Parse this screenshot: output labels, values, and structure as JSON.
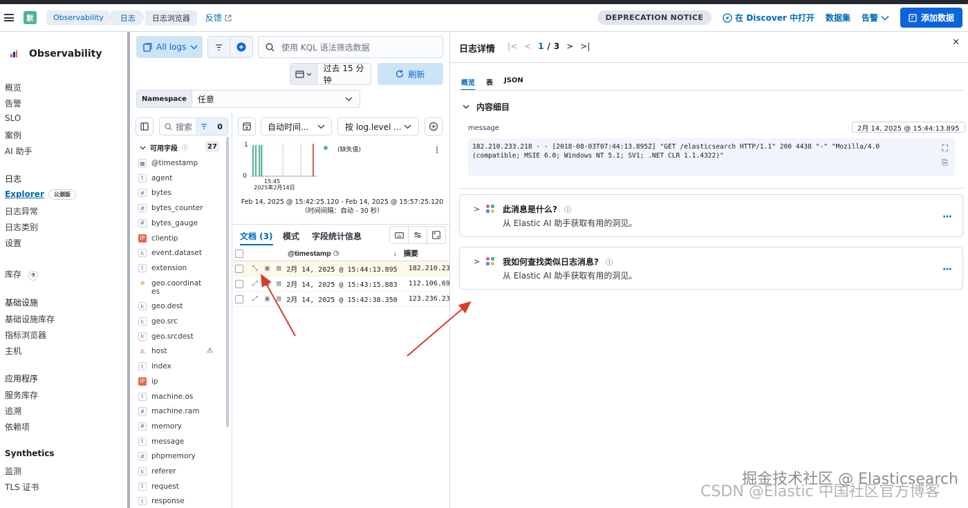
{
  "header": {
    "space_initial": "默",
    "breadcrumbs": [
      "Observability",
      "日志",
      "日志浏览器"
    ],
    "feedback": "反馈",
    "deprecation": "DEPRECATION NOTICE",
    "open_in_discover": "在 Discover 中打开",
    "datasets": "数据集",
    "alerts": "告警",
    "add_data": "添加数据"
  },
  "sidebar": {
    "brand": "Observability",
    "items": [
      {
        "label": "概览",
        "type": "item"
      },
      {
        "label": "告警",
        "type": "item"
      },
      {
        "label": "SLO",
        "type": "item"
      },
      {
        "label": "案例",
        "type": "item"
      },
      {
        "label": "AI 助手",
        "type": "item"
      },
      {
        "label": "日志",
        "type": "group"
      },
      {
        "label": "Explorer",
        "type": "active",
        "badge": "公测版"
      },
      {
        "label": "日志异常",
        "type": "item"
      },
      {
        "label": "日志类别",
        "type": "item"
      },
      {
        "label": "设置",
        "type": "item"
      },
      {
        "label": "库存",
        "type": "group-plain"
      },
      {
        "label": "基础设施",
        "type": "group"
      },
      {
        "label": "基础设施库存",
        "type": "item"
      },
      {
        "label": "指标浏览器",
        "type": "item"
      },
      {
        "label": "主机",
        "type": "item"
      },
      {
        "label": "应用程序",
        "type": "group"
      },
      {
        "label": "服务库存",
        "type": "item"
      },
      {
        "label": "追溯",
        "type": "item"
      },
      {
        "label": "依赖项",
        "type": "item"
      },
      {
        "label": "Synthetics",
        "type": "group"
      },
      {
        "label": "监测",
        "type": "item"
      },
      {
        "label": "TLS 证书",
        "type": "item"
      }
    ]
  },
  "filters": {
    "dataview": "All logs",
    "kql_placeholder": "使用 KQL 语法筛选数据",
    "time_range": "过去 15 分钟",
    "refresh": "刷新",
    "namespace_label": "Namespace",
    "namespace_value": "任意"
  },
  "fields": {
    "search": "搜索",
    "filter_count": "0",
    "available_label": "可用字段",
    "available_count": "27",
    "list": [
      {
        "name": "@timestamp",
        "type": "calendar"
      },
      {
        "name": "agent",
        "type": "t"
      },
      {
        "name": "bytes",
        "type": "#"
      },
      {
        "name": "bytes_counter",
        "type": "#"
      },
      {
        "name": "bytes_gauge",
        "type": "#"
      },
      {
        "name": "clientip",
        "type": "ip"
      },
      {
        "name": "event.dataset",
        "type": "k"
      },
      {
        "name": "extension",
        "type": "t"
      },
      {
        "name": "geo.coordinat es",
        "type": "geo"
      },
      {
        "name": "geo.dest",
        "type": "k"
      },
      {
        "name": "geo.src",
        "type": "k"
      },
      {
        "name": "geo.srcdest",
        "type": "k"
      },
      {
        "name": "host",
        "type": "warn"
      },
      {
        "name": "index",
        "type": "t"
      },
      {
        "name": "ip",
        "type": "ip"
      },
      {
        "name": "machine.os",
        "type": "t"
      },
      {
        "name": "machine.ram",
        "type": "#"
      },
      {
        "name": "memory",
        "type": "#"
      },
      {
        "name": "message",
        "type": "t"
      },
      {
        "name": "phpmemory",
        "type": "#"
      },
      {
        "name": "referer",
        "type": "k"
      },
      {
        "name": "request",
        "type": "t"
      },
      {
        "name": "response",
        "type": "t"
      }
    ]
  },
  "histogram": {
    "interval_select": "自动时间...",
    "breakdown_select": "按 log.level ...",
    "y_top": "1",
    "y_bottom": "0",
    "x_tick_time": "15:45",
    "x_tick_date": "2025年2月14日",
    "legend": "(缺失值)",
    "range_text": "Feb 14, 2025 @ 15:42:25.120 - Feb 14, 2025 @ 15:57:25.120 （时间间隔：自动 - 30 秒）"
  },
  "table": {
    "tabs": [
      "文档 (3)",
      "模式",
      "字段统计信息"
    ],
    "col_timestamp": "@timestamp",
    "col_summary": "摘要",
    "rows": [
      {
        "ts": "2月 14, 2025 @ 15:44:13.895",
        "summary": "182.210.23"
      },
      {
        "ts": "2月 14, 2025 @ 15:43:15.883",
        "summary": "112.106.69"
      },
      {
        "ts": "2月 14, 2025 @ 15:42:38.350",
        "summary": "123.236.23"
      }
    ]
  },
  "flyout": {
    "title": "日志详情",
    "pager_current": "1",
    "pager_sep": "/",
    "pager_total": "3",
    "tabs": [
      "概览",
      "表",
      "JSON"
    ],
    "section_title": "内容细目",
    "message_label": "message",
    "message_timestamp": "2月 14, 2025 @ 15:44:13.895",
    "message_line1": "182.210.233.218 - - [2018-08-03T07:44:13.895Z] \"GET /elasticsearch HTTP/1.1\" 200 4438 \"-\" \"Mozilla/4.0",
    "message_line2": "(compatible; MSIE 6.0; Windows NT 5.1; SV1; .NET CLR 1.1.4322)\"",
    "ai_cards": [
      {
        "title": "此消息是什么?",
        "subtitle": "从 Elastic AI 助手获取有用的洞见。"
      },
      {
        "title": "我如何查找类似日志消息?",
        "subtitle": "从 Elastic AI 助手获取有用的洞见。"
      }
    ]
  },
  "watermark": "CSDN @Elastic 中国社区官方博客",
  "watermark_overlay": "掘金技术社区 @ Elasticsearch"
}
